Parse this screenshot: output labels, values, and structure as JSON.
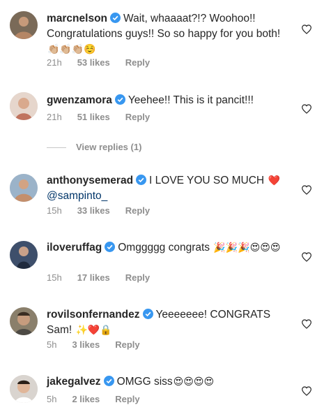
{
  "colors": {
    "username": "#262626",
    "meta": "#8e8e8e",
    "verified": "#3897f0",
    "mention": "#003569",
    "heart_red": "#ed4956"
  },
  "comments": [
    {
      "username": "marcnelson",
      "text_parts": [
        "Wait, whaaaat?!? Woohoo!! Congratulations guys!! So so happy for you both!"
      ],
      "emojis": "👏🏼👏🏼👏🏼☺️",
      "time": "21h",
      "likes": "53 likes",
      "reply": "Reply"
    },
    {
      "username": "gwenzamora",
      "text_parts": [
        "Yeehee!! This is it pancit!!!"
      ],
      "time": "21h",
      "likes": "51 likes",
      "reply": "Reply"
    },
    {
      "username": "anthonysemerad",
      "text_parts": [
        "I LOVE YOU SO MUCH"
      ],
      "emojis": "❤️",
      "mention": "@sampinto_",
      "time": "15h",
      "likes": "33 likes",
      "reply": "Reply"
    },
    {
      "username": "iloveruffag",
      "text_parts": [
        "Omggggg congrats"
      ],
      "emojis": "🎉🎉🎉😍😍😍",
      "time": "15h",
      "likes": "17 likes",
      "reply": "Reply"
    },
    {
      "username": "rovilsonfernandez",
      "text_parts": [
        "Yeeeeeee! CONGRATS Sam!"
      ],
      "emojis": "✨❤️🔒",
      "time": "5h",
      "likes": "3 likes",
      "reply": "Reply"
    },
    {
      "username": "jakegalvez",
      "text_parts": [
        "OMGG siss"
      ],
      "emojis": "😍😍😍😍",
      "time": "5h",
      "likes": "2 likes",
      "reply": "Reply"
    }
  ],
  "view_replies": "View replies (1)",
  "icons": {
    "verified": "verified-badge-icon",
    "like": "heart-outline-icon"
  }
}
